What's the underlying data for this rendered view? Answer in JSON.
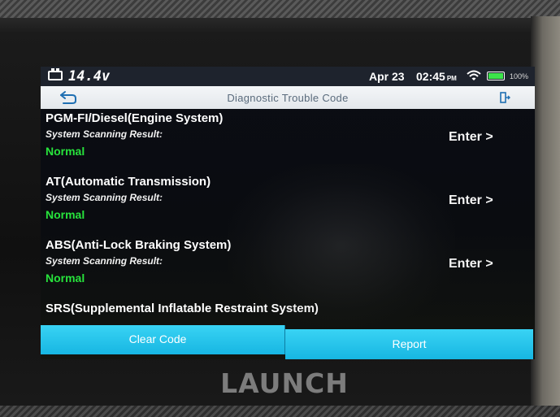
{
  "status_bar": {
    "voltage": "14.4v",
    "date": "Apr 23",
    "time": "02:45",
    "ampm": "PM",
    "battery_percent": "100%",
    "battery_level": 1.0,
    "icons": [
      "car-battery-icon",
      "wifi-icon",
      "battery-icon"
    ]
  },
  "title_bar": {
    "title": "Diagnostic Trouble Code",
    "icons": [
      "back-arrow-icon",
      "exit-icon"
    ]
  },
  "systems": [
    {
      "name": "PGM-FI/Diesel(Engine System)",
      "scan_label": "System Scanning Result:",
      "result": "Normal",
      "action": "Enter >"
    },
    {
      "name": "AT(Automatic Transmission)",
      "scan_label": "System Scanning Result:",
      "result": "Normal",
      "action": "Enter >"
    },
    {
      "name": "ABS(Anti-Lock Braking System)",
      "scan_label": "System Scanning Result:",
      "result": "Normal",
      "action": "Enter >"
    },
    {
      "name": "SRS(Supplemental Inflatable Restraint System)"
    }
  ],
  "actions": {
    "clear_code": "Clear Code",
    "report": "Report"
  },
  "device": {
    "brand": "LAUNCH"
  },
  "colors": {
    "accent": "#1fbfe8",
    "status_normal": "#27e33c",
    "title_bar": "#eceff2",
    "title_text": "#5a6b7c"
  }
}
